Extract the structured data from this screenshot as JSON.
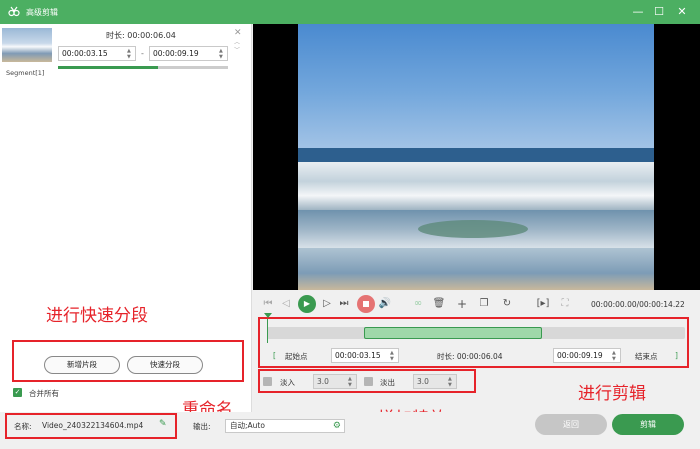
{
  "window": {
    "title": "高级剪辑",
    "minimize_label": "—",
    "maximize_label": "☐",
    "close_label": "✕"
  },
  "segment": {
    "label": "Segment[1]",
    "duration_label": "时长: 00:00:06.04",
    "start_time": "00:00:03.15",
    "separator": "-",
    "end_time": "00:00:09.19",
    "progress": 0.59
  },
  "left_panel": {
    "new_segment_button": "新增片段",
    "quick_split_button": "快速分段",
    "merge_all_label": "合并所有",
    "merge_all_checked": true
  },
  "player": {
    "timecode": "00:00:00.00/00:00:14.22"
  },
  "trim": {
    "start_point_button": "起始点",
    "start_time": "00:00:03.15",
    "duration_label": "时长: 00:00:06.04",
    "end_time": "00:00:09.19",
    "end_point_button": "结束点"
  },
  "effects": {
    "fade_in_label": "淡入",
    "fade_in_value": "3.0",
    "fade_out_label": "淡出",
    "fade_out_value": "3.0"
  },
  "bottom": {
    "name_label": "名称:",
    "name_value": "Video_240322134604.mp4",
    "output_label": "输出:",
    "output_value": "自动;Auto",
    "back_button": "返回",
    "cut_button": "剪辑"
  },
  "annotations": {
    "quick_split": "进行快速分段",
    "rename": "重命名",
    "effects": "增加特效",
    "edit": "进行剪辑"
  },
  "colors": {
    "brand_green": "#3a9a50",
    "titlebar_green": "#4caf62",
    "annotation_red": "#e6232a"
  }
}
